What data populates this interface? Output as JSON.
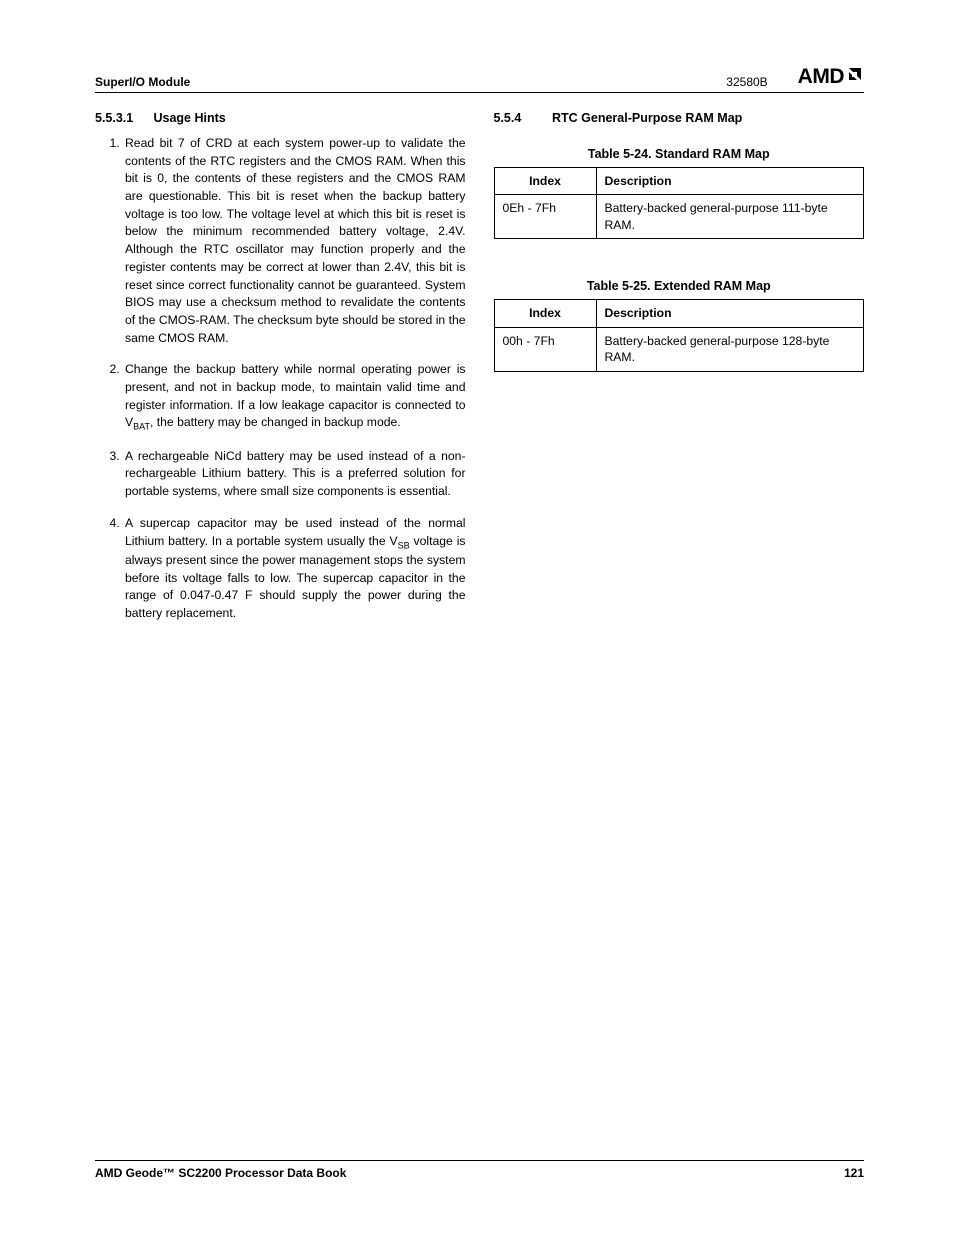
{
  "header": {
    "module": "SuperI/O Module",
    "doc_number": "32580B",
    "logo_text": "AMD"
  },
  "left_section": {
    "number": "5.5.3.1",
    "title": "Usage Hints",
    "items": [
      {
        "n": "1)",
        "text_pre": "Read bit 7 of CRD at each system power-up to validate the contents of the RTC registers and the CMOS RAM. When this bit is 0, the contents of these registers and the CMOS RAM are questionable. This bit is reset when the backup battery voltage is too low. The voltage level at which this bit is reset is below the minimum recommended battery voltage, 2.4V. Although the RTC oscillator may function properly and the register contents may be correct at lower than 2.4V, this bit is reset since correct functionality cannot be guaranteed. System BIOS may use a checksum method to revalidate the contents of the CMOS-RAM. The checksum byte should be stored in the same CMOS RAM.",
        "has_sub": false
      },
      {
        "n": "2)",
        "text_pre": "Change the backup battery while normal operating power is present, and not in backup mode, to maintain valid time and register information. If a low leakage capacitor is connected to V",
        "sub": "BAT",
        "text_post": ", the battery may be changed in backup mode.",
        "has_sub": true
      },
      {
        "n": "3)",
        "text_pre": "A rechargeable NiCd battery may be used instead of a non-rechargeable Lithium battery. This is a preferred solution for portable systems, where small size components is essential.",
        "has_sub": false
      },
      {
        "n": "4)",
        "text_pre": "A supercap capacitor may be used instead of the normal Lithium battery. In a portable system usually the V",
        "sub": "SB",
        "text_post": " voltage is always present since the power management stops the system before its voltage falls to low. The supercap capacitor in the range of 0.047-0.47 F should supply the power during the battery replacement.",
        "has_sub": true
      }
    ]
  },
  "right_section": {
    "number": "5.5.4",
    "title": "RTC General-Purpose RAM Map",
    "tables": [
      {
        "caption": "Table 5-24.  Standard RAM Map",
        "headers": {
          "index": "Index",
          "desc": "Description"
        },
        "rows": [
          {
            "index": "0Eh - 7Fh",
            "desc": "Battery-backed general-purpose 111-byte RAM."
          }
        ]
      },
      {
        "caption": "Table 5-25.  Extended RAM Map",
        "headers": {
          "index": "Index",
          "desc": "Description"
        },
        "rows": [
          {
            "index": "00h - 7Fh",
            "desc": "Battery-backed general-purpose 128-byte RAM."
          }
        ]
      }
    ]
  },
  "footer": {
    "book": "AMD Geode™ SC2200  Processor Data Book",
    "page": "121"
  }
}
